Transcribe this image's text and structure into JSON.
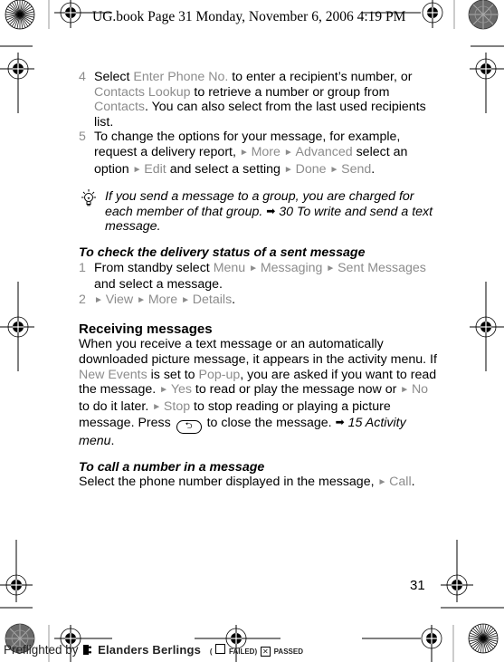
{
  "slug": "UG.book  Page 31  Monday, November 6, 2006  4:19 PM",
  "steps_a": [
    {
      "num": "4",
      "parts": [
        {
          "t": "Select "
        },
        {
          "t": "Enter Phone No.",
          "ui": true
        },
        {
          "t": " to enter a recipient’s number, or "
        },
        {
          "t": "Contacts Lookup",
          "ui": true
        },
        {
          "t": " to retrieve a number or group from "
        },
        {
          "t": "Contacts",
          "ui": true
        },
        {
          "t": ". You can also select from the last used recipients list."
        }
      ]
    },
    {
      "num": "5",
      "parts": [
        {
          "t": "To change the options for your message, for example, request a delivery report, "
        },
        {
          "arrow": true
        },
        {
          "t": "More",
          "ui": true
        },
        {
          "t": " "
        },
        {
          "arrow": true
        },
        {
          "t": "Advanced",
          "ui": true
        },
        {
          "t": " select an option "
        },
        {
          "arrow": true
        },
        {
          "t": "Edit",
          "ui": true
        },
        {
          "t": " and select a setting "
        },
        {
          "arrow": true
        },
        {
          "t": "Done",
          "ui": true
        },
        {
          "t": " "
        },
        {
          "arrow": true
        },
        {
          "t": "Send",
          "ui": true
        },
        {
          "t": "."
        }
      ]
    }
  ],
  "tip": {
    "icon": "lightbulb-icon",
    "text": "If you send a message to a group, you are charged for each member of that group. ",
    "ref_icon": "➡",
    "ref_text": " 30 To write and send a text message."
  },
  "delivery": {
    "heading": "To check the delivery status of a sent message",
    "steps": [
      {
        "num": "1",
        "parts": [
          {
            "t": "From standby select "
          },
          {
            "t": "Menu",
            "ui": true
          },
          {
            "t": " "
          },
          {
            "arrow": true
          },
          {
            "t": "Messaging",
            "ui": true
          },
          {
            "t": " "
          },
          {
            "arrow": true
          },
          {
            "t": "Sent Messages",
            "ui": true
          },
          {
            "t": " and select a message."
          }
        ]
      },
      {
        "num": "2",
        "parts": [
          {
            "arrow": true
          },
          {
            "t": "View",
            "ui": true
          },
          {
            "t": " "
          },
          {
            "arrow": true
          },
          {
            "t": "More",
            "ui": true
          },
          {
            "t": " "
          },
          {
            "arrow": true
          },
          {
            "t": "Details",
            "ui": true
          },
          {
            "t": "."
          }
        ]
      }
    ]
  },
  "receiving": {
    "heading": "Receiving messages",
    "parts": [
      {
        "t": "When you receive a text message or an automatically downloaded picture message, it appears in the activity menu. If "
      },
      {
        "t": "New Events",
        "ui": true
      },
      {
        "t": " is set to "
      },
      {
        "t": "Pop-up",
        "ui": true
      },
      {
        "t": ", you are asked if you want to read the message. "
      },
      {
        "arrow": true
      },
      {
        "t": "Yes",
        "ui": true
      },
      {
        "t": " to read or play the message now or "
      },
      {
        "arrow": true
      },
      {
        "t": "No",
        "ui": true
      },
      {
        "t": " to do it later. "
      },
      {
        "arrow": true
      },
      {
        "t": "Stop",
        "ui": true
      },
      {
        "t": " to stop reading or playing a picture message. Press "
      },
      {
        "key": "back-key"
      },
      {
        "t": " to close the message. "
      },
      {
        "ref": "➡",
        "text": " 15 Activity menu"
      },
      {
        "t": "."
      }
    ]
  },
  "call": {
    "heading": "To call a number in a message",
    "parts": [
      {
        "t": "Select the phone number displayed in the message, "
      },
      {
        "arrow": true
      },
      {
        "t": "Call",
        "ui": true
      },
      {
        "t": "."
      }
    ]
  },
  "page_number": "31",
  "preflight": {
    "prefix": "Preflighted by",
    "brand": "Elanders Berlings",
    "failed_label": "FAILED",
    "passed_label": "PASSED",
    "failed_checked": false,
    "passed_checked": true
  },
  "colors": {
    "ui_text": "#8c8c8c",
    "body_text": "#000000"
  },
  "glyphs": {
    "arrow": "►",
    "back_key": "⮌"
  }
}
